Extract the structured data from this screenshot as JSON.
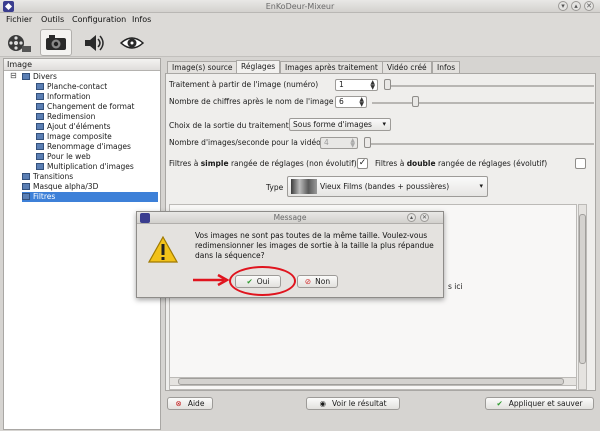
{
  "window": {
    "title": "EnKoDeur-Mixeur"
  },
  "menubar": {
    "items": [
      {
        "id": "fichier",
        "label": "Fichier"
      },
      {
        "id": "outils",
        "label": "Outils"
      },
      {
        "id": "configuration",
        "label": "Configuration"
      },
      {
        "id": "infos",
        "label": "Infos"
      }
    ]
  },
  "toolbar": {
    "items": [
      "film-reel-icon",
      "camera-icon",
      "speaker-icon",
      "eye-icon"
    ],
    "active": 1
  },
  "tree": {
    "header": "Image",
    "nodes": [
      {
        "label": "Divers",
        "level": 1
      },
      {
        "label": "Planche-contact",
        "level": 2
      },
      {
        "label": "Information",
        "level": 2
      },
      {
        "label": "Changement de format",
        "level": 2
      },
      {
        "label": "Redimension",
        "level": 2
      },
      {
        "label": "Ajout d'éléments",
        "level": 2
      },
      {
        "label": "Image composite",
        "level": 2
      },
      {
        "label": "Renommage d'images",
        "level": 2
      },
      {
        "label": "Pour le web",
        "level": 2
      },
      {
        "label": "Multiplication d'images",
        "level": 2
      },
      {
        "label": "Transitions",
        "level": 1
      },
      {
        "label": "Masque alpha/3D",
        "level": 1
      },
      {
        "label": "Filtres",
        "level": 1,
        "selected": true
      }
    ]
  },
  "tabs": [
    {
      "label": "Image(s) source"
    },
    {
      "label": "Réglages",
      "active": true
    },
    {
      "label": "Images après traitement"
    },
    {
      "label": "Vidéo créé"
    },
    {
      "label": "Infos"
    }
  ],
  "settings": {
    "start_label": "Traitement à partir de l'image (numéro)",
    "start_value": "1",
    "digits_label": "Nombre de chiffres après le nom de l'image",
    "digits_value": "6",
    "output_label": "Choix de la sortie du traitement",
    "output_value": "Sous forme d'images",
    "fps_label": "Nombre d'images/seconde pour la vidéo",
    "fps_value": "4",
    "simple_prefix": "Filtres à ",
    "simple_bold": "simple",
    "simple_suffix": " rangée de réglages (non évolutif)",
    "simple_checked": true,
    "double_prefix": "Filtres à ",
    "double_bold": "double",
    "double_suffix": " rangée de réglages (évolutif)",
    "double_checked": false,
    "type_label": "Type",
    "type_value": "Vieux Films (bandes + poussières)",
    "hidden_text_fragment": "s ici"
  },
  "buttons": {
    "aide": "Aide",
    "voir": "Voir le résultat",
    "appliquer": "Appliquer et sauver"
  },
  "dialog": {
    "title": "Message",
    "message": "Vos images ne sont pas toutes de la même taille. Voulez-vous redimensionner les images de sortie à la taille la plus répandue dans la séquence?",
    "oui": "Oui",
    "non": "Non"
  },
  "colors": {
    "selection": "#3d80d8",
    "annotation_red": "#e0141e",
    "warning_yellow": "#f2c21a"
  }
}
